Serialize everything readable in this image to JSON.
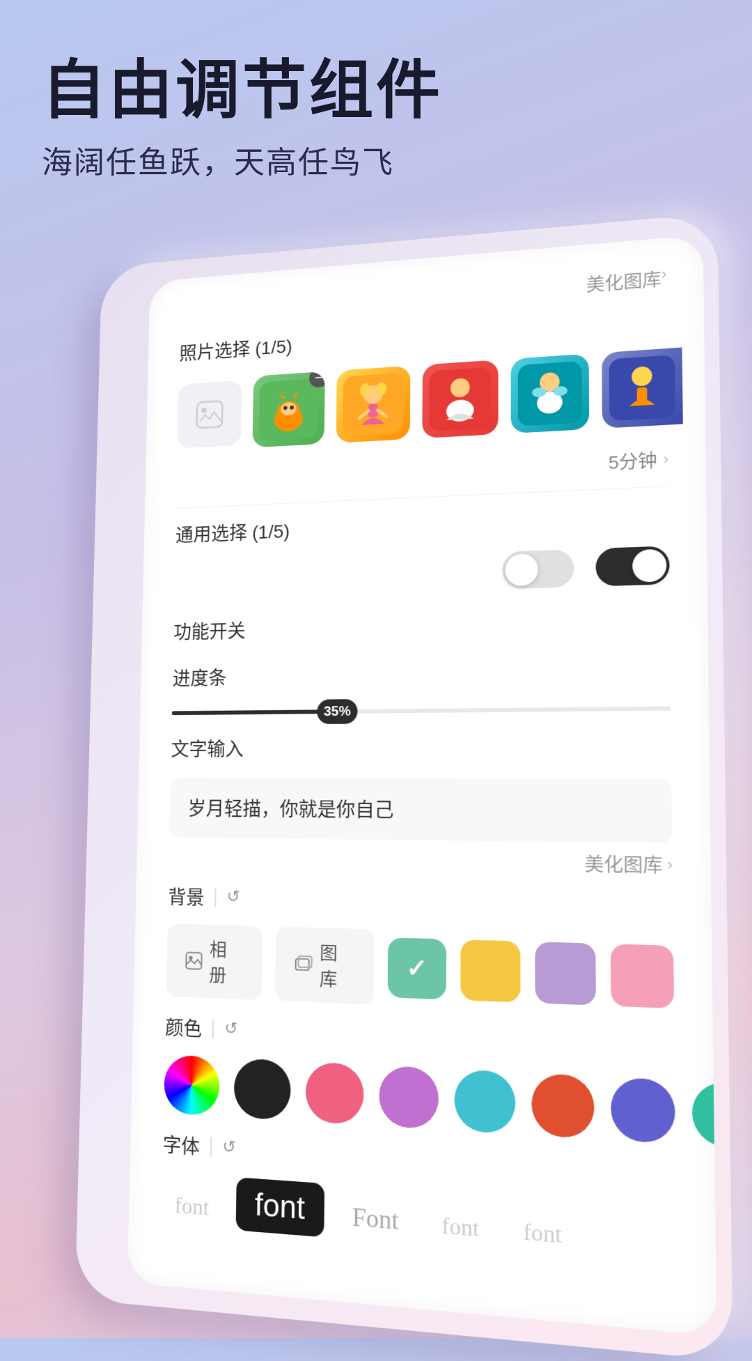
{
  "header": {
    "title": "自由调节组件",
    "subtitle": "海阔任鱼跃，天高任鸟飞"
  },
  "card": {
    "library_link": "美化图库",
    "photos_section": {
      "label": "照片选择 (1/5)",
      "thumbnails": [
        {
          "emoji": "🦊",
          "bg": "thumb-green"
        },
        {
          "emoji": "👧",
          "bg": "thumb-yellow"
        },
        {
          "emoji": "🧍",
          "bg": "thumb-red"
        },
        {
          "emoji": "👼",
          "bg": "thumb-teal"
        },
        {
          "emoji": "🧚",
          "bg": "thumb-blue"
        }
      ]
    },
    "time": {
      "value": "5分钟",
      "chevron": ">"
    },
    "general_section": {
      "label": "通用选择 (1/5)"
    },
    "feature_section": {
      "label": "功能开关"
    },
    "progress_section": {
      "label": "进度条",
      "value": 35,
      "display": "35%"
    },
    "text_input_section": {
      "label": "文字输入",
      "value": "岁月轻描，你就是你自己",
      "library_link": "美化图库"
    },
    "background_section": {
      "label": "背景",
      "btn1": "相册",
      "btn2": "图库",
      "swatches": [
        "#6cc5a8",
        "#f5c842",
        "#b89bd4",
        "#f5a0b8"
      ]
    },
    "color_section": {
      "label": "颜色",
      "colors": [
        "wheel",
        "#222222",
        "#f06080",
        "#c070d0",
        "#40c0d0",
        "#e05030",
        "#6060d0",
        "#30c0a0"
      ]
    },
    "font_section": {
      "label": "字体",
      "samples": [
        {
          "text": "font",
          "style": "lighter",
          "font": "serif"
        },
        {
          "text": "font",
          "style": "selected",
          "font": "sans-serif"
        },
        {
          "text": "Font",
          "style": "light",
          "font": "serif"
        },
        {
          "text": "font",
          "style": "lighter",
          "font": "cursive"
        },
        {
          "text": "font",
          "style": "lighter",
          "font": "fantasy"
        }
      ]
    }
  },
  "icons": {
    "refresh": "↺",
    "chevron": "›",
    "divider": "|",
    "album_icon": "⊞",
    "gallery_icon": "⊟"
  }
}
